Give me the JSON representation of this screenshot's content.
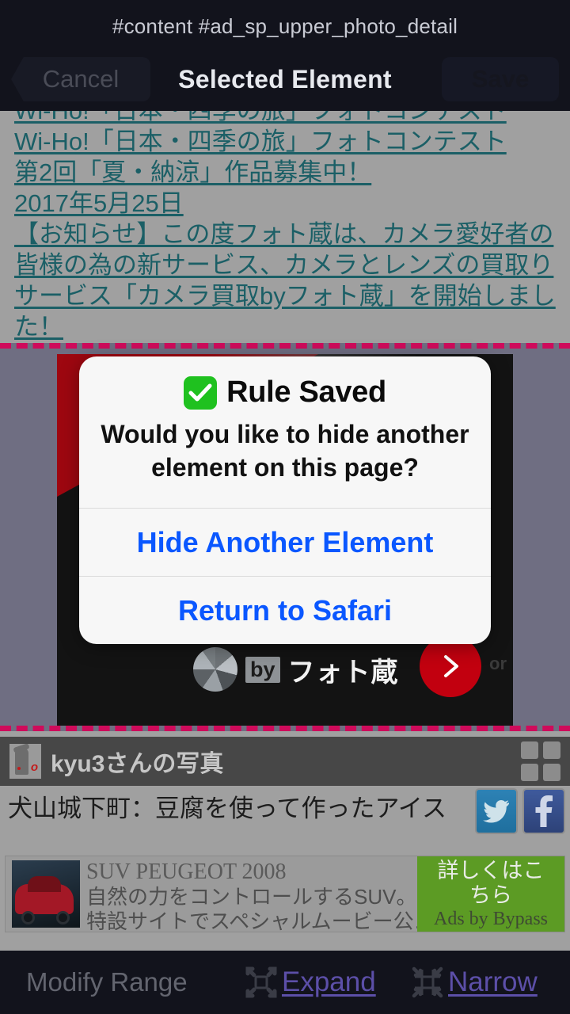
{
  "topbar": {
    "selector_path": "#content #ad_sp_upper_photo_detail",
    "cancel_label": "Cancel",
    "title": "Selected Element",
    "save_label": "Save"
  },
  "webpage": {
    "text_links": [
      "Wi-Ho!「日本・四季の旅」フォトコンテスト",
      "第2回「夏・納涼」作品募集中！",
      "2017年5月25日",
      "【お知らせ】この度フォト蔵は、カメラ愛好者の",
      "皆様の為の新サービス、カメラとレンズの買取り",
      "サービス「カメラ買取byフォト蔵」を開始しまし",
      "た！"
    ],
    "banner": {
      "by_chip": "by",
      "brand": "フォト蔵",
      "corner_mark": "or"
    },
    "photo_header": {
      "title": "kyu3さんの写真"
    },
    "photo_title": "犬山城下町：豆腐を使って作ったアイス",
    "ad": {
      "title": "SUV PEUGEOT 2008",
      "line1": "自然の力をコントロールするSUV。",
      "line2": "特設サイトでスペシャルムービー公…",
      "cta": "詳しくはこちら",
      "attribution": "Ads by Bypass"
    }
  },
  "dialog": {
    "title": "Rule Saved",
    "message": "Would you like to hide another element on this page?",
    "primary_button": "Hide Another Element",
    "secondary_button": "Return to Safari"
  },
  "bottombar": {
    "label": "Modify Range",
    "expand_label": "Expand",
    "narrow_label": "Narrow"
  },
  "colors": {
    "accent_link": "#0a57ff",
    "selection_border": "#cf0b5b",
    "toolbar_link": "#5c4fa8",
    "success_green": "#1fc11f",
    "ad_cta_green": "#5c9b24"
  }
}
